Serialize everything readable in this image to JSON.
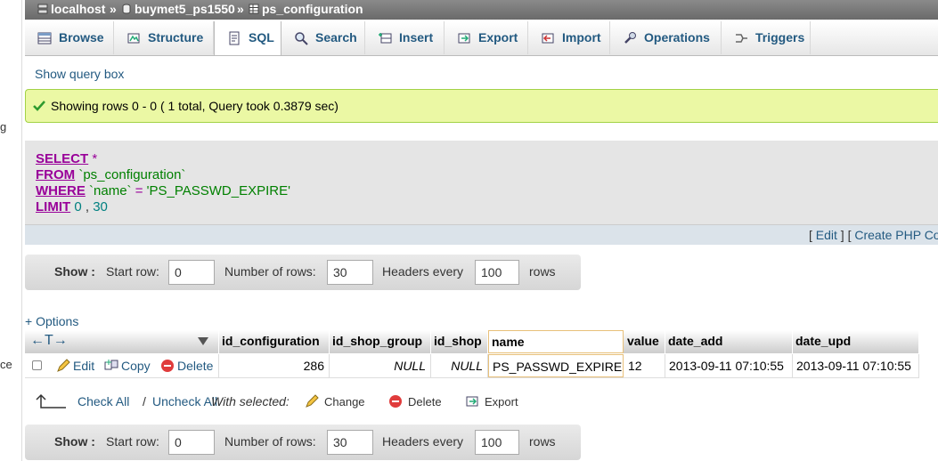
{
  "left_edge": {
    "text1": "g",
    "text2": "ce"
  },
  "breadcrumb": {
    "server": "localhost",
    "sep1": "»",
    "database": "buymet5_ps1550",
    "sep2": "»",
    "table": "ps_configuration"
  },
  "tabs": [
    {
      "label": "Browse",
      "icon": "browse-icon"
    },
    {
      "label": "Structure",
      "icon": "structure-icon"
    },
    {
      "label": "SQL",
      "icon": "sql-icon",
      "active": true
    },
    {
      "label": "Search",
      "icon": "search-icon"
    },
    {
      "label": "Insert",
      "icon": "insert-icon"
    },
    {
      "label": "Export",
      "icon": "export-icon"
    },
    {
      "label": "Import",
      "icon": "import-icon"
    },
    {
      "label": "Operations",
      "icon": "operations-icon"
    },
    {
      "label": "Triggers",
      "icon": "triggers-icon"
    }
  ],
  "show_query_box": "Show query box",
  "success_message": "Showing rows 0 - 0 ( 1 total, Query took 0.3879 sec)",
  "sql": {
    "select_kw": "SELECT",
    "star": "*",
    "from_kw": "FROM",
    "table": "`ps_configuration`",
    "where_kw": "WHERE",
    "column": "`name`",
    "op": "=",
    "value": "'PS_PASSWD_EXPIRE'",
    "limit_kw": "LIMIT",
    "limit_start": "0",
    "limit_sep": ",",
    "limit_count": "30",
    "footer_open": "[",
    "edit_link": "Edit",
    "footer_mid": "] [",
    "create_php_link": "Create PHP Code"
  },
  "show_bar": {
    "show_label": "Show :",
    "start_row_label": "Start row:",
    "start_row_value": "0",
    "num_rows_label": "Number of rows:",
    "num_rows_value": "30",
    "headers_every_label": "Headers every",
    "headers_every_value": "100",
    "rows_label": "rows"
  },
  "options_link": "+ Options",
  "table": {
    "arrows": "←T→",
    "sort_icon": "sort-triangle-icon",
    "headers": [
      "id_configuration",
      "id_shop_group",
      "id_shop",
      "name",
      "value",
      "date_add",
      "date_upd"
    ],
    "row_actions": {
      "edit": "Edit",
      "copy": "Copy",
      "delete": "Delete"
    },
    "rows": [
      [
        "286",
        "NULL",
        "NULL",
        "PS_PASSWD_EXPIRE",
        "12",
        "2013-09-11 07:10:55",
        "2013-09-11 07:10:55"
      ]
    ]
  },
  "bulk": {
    "check_all": "Check All",
    "slash": "/",
    "uncheck_all": "Uncheck All",
    "with_selected": "With selected:",
    "change": "Change",
    "delete": "Delete",
    "export": "Export"
  },
  "colors": {
    "link": "#235a81",
    "keyword": "#990099",
    "success_bg": "#ebf8a4",
    "success_border": "#a2d246"
  }
}
